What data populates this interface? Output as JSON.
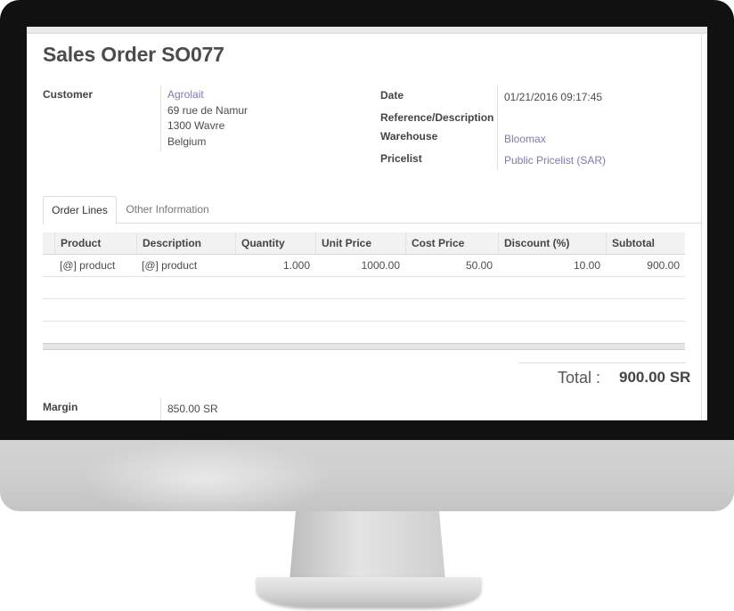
{
  "order": {
    "title": "Sales Order SO077",
    "customer_label": "Customer",
    "customer_name": "Agrolait",
    "customer_address": [
      "69 rue de Namur",
      "1300 Wavre",
      "Belgium"
    ],
    "date_label": "Date",
    "date_value": "01/21/2016 09:17:45",
    "reference_label": "Reference/Description",
    "warehouse_label": "Warehouse",
    "warehouse_value": "Bloomax",
    "pricelist_label": "Pricelist",
    "pricelist_value": "Public Pricelist (SAR)"
  },
  "tabs": [
    {
      "label": "Order Lines",
      "active": true
    },
    {
      "label": "Other Information",
      "active": false
    }
  ],
  "table": {
    "columns": [
      "Product",
      "Description",
      "Quantity",
      "Unit Price",
      "Cost Price",
      "Discount (%)",
      "Subtotal"
    ],
    "rows": [
      {
        "product": "[@] product",
        "description": "[@] product",
        "quantity": "1.000",
        "unit_price": "1000.00",
        "cost_price": "50.00",
        "discount": "10.00",
        "subtotal": "900.00"
      }
    ]
  },
  "summary": {
    "total_label": "Total :",
    "total_value": "900.00 SR",
    "margin_label": "Margin",
    "margin_value": "850.00 SR"
  },
  "colors": {
    "link": "#7c7bad",
    "bezel": "#111111",
    "header_bg": "#f2f2f2"
  }
}
